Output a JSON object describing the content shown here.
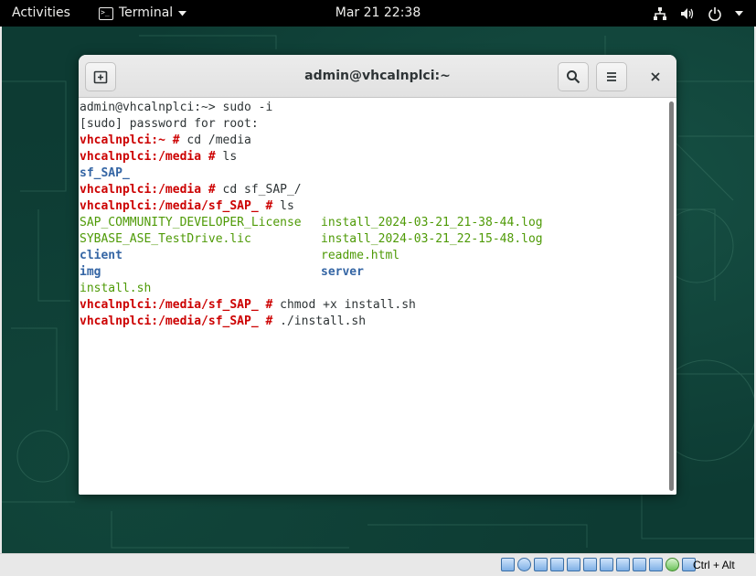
{
  "topbar": {
    "activities": "Activities",
    "app_name": "Terminal",
    "clock": "Mar 21  22:38",
    "icons": [
      "network-icon",
      "volume-icon",
      "power-icon",
      "chevron-down-icon"
    ]
  },
  "window": {
    "title": "admin@vhcalnplci:~",
    "buttons": [
      "new-tab-icon",
      "search-icon",
      "hamburger-menu-icon",
      "close-icon"
    ]
  },
  "terminal": {
    "lines": [
      [
        {
          "t": "admin@vhcalnplci:~> sudo -i",
          "c": ""
        }
      ],
      [
        {
          "t": "[sudo] password for root:",
          "c": ""
        }
      ],
      [
        {
          "t": "vhcalnplci:~ #",
          "c": "prompt"
        },
        {
          "t": " cd /media",
          "c": ""
        }
      ],
      [
        {
          "t": "vhcalnplci:/media #",
          "c": "prompt"
        },
        {
          "t": " ls",
          "c": ""
        }
      ],
      [
        {
          "t": "sf_SAP_",
          "c": "dir"
        }
      ],
      [
        {
          "t": "vhcalnplci:/media #",
          "c": "prompt"
        },
        {
          "t": " cd sf_SAP_/",
          "c": ""
        }
      ],
      [
        {
          "t": "vhcalnplci:/media/sf_SAP_ #",
          "c": "prompt"
        },
        {
          "t": " ls",
          "c": ""
        }
      ],
      {
        "cols": [
          {
            "t": "SAP_COMMUNITY_DEVELOPER_License",
            "c": "file"
          },
          {
            "t": "install_2024-03-21_21-38-44.log",
            "c": "file"
          }
        ]
      },
      {
        "cols": [
          {
            "t": "SYBASE_ASE_TestDrive.lic",
            "c": "file"
          },
          {
            "t": "install_2024-03-21_22-15-48.log",
            "c": "file"
          }
        ]
      },
      {
        "cols": [
          {
            "t": "client",
            "c": "dir"
          },
          {
            "t": "readme.html",
            "c": "file"
          }
        ]
      },
      {
        "cols": [
          {
            "t": "img",
            "c": "dir"
          },
          {
            "t": "server",
            "c": "dir"
          }
        ]
      },
      [
        {
          "t": "install.sh",
          "c": "file"
        }
      ],
      [
        {
          "t": "vhcalnplci:/media/sf_SAP_ #",
          "c": "prompt"
        },
        {
          "t": " chmod +x install.sh",
          "c": ""
        }
      ],
      [
        {
          "t": "vhcalnplci:/media/sf_SAP_ #",
          "c": "prompt"
        },
        {
          "t": " ./install.sh",
          "c": ""
        }
      ]
    ]
  },
  "statusbar": {
    "host_key": "Ctrl + Alt",
    "icons": [
      "hard-disk-icon",
      "optical-drive-icon",
      "audio-icon",
      "network-adapter-icon",
      "usb-icon",
      "shared-folder-icon",
      "display-icon",
      "video-capture-icon",
      "recording-icon",
      "cpu-icon",
      "mouse-integration-icon",
      "keyboard-icon"
    ]
  },
  "colors": {
    "prompt": "#cc0000",
    "directory": "#3465a4",
    "file": "#4e9a06",
    "desktop": "#0d3b33"
  }
}
